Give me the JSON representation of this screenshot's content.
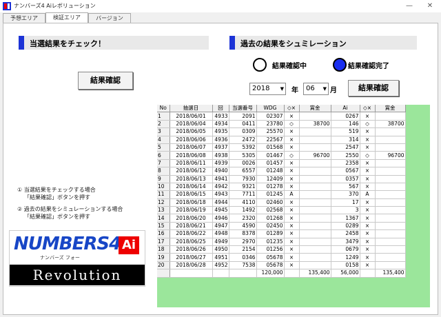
{
  "window": {
    "title": "ナンバーズ4 Aiレボリューション",
    "minimize": "—",
    "close": "✕"
  },
  "tabs": [
    {
      "label": "予想エリア"
    },
    {
      "label": "検証エリア"
    },
    {
      "label": "バージョン"
    }
  ],
  "left": {
    "heading": "当選結果をチェック！",
    "check_button": "結果確認",
    "note1_line1": "① 当選結果をチェックする場合",
    "note1_line2": "「結果確認」ボタンを押す",
    "note2_line1": "② 過去の結果をシミュレーションする場合",
    "note2_line2": "「結果確認」ボタンを押す"
  },
  "right": {
    "heading": "過去の結果をシュミレーション",
    "radio_pending": "結果確認中",
    "radio_done": "結果確認完了",
    "year": "2018",
    "year_suffix": "年",
    "month": "06",
    "month_suffix": "月",
    "check_button": "結果確認"
  },
  "table": {
    "headers": [
      "No",
      "抽選日",
      "回",
      "当選番号",
      "WDG",
      "◇×",
      "賞金",
      "Ai",
      "◇×",
      "賞金"
    ],
    "rows": [
      [
        "1",
        "2018/06/01",
        "4933",
        "2091",
        "02307",
        "×",
        "",
        "0267",
        "×",
        ""
      ],
      [
        "2",
        "2018/06/04",
        "4934",
        "0411",
        "23780",
        "◇",
        "38700",
        "146",
        "◇",
        "38700"
      ],
      [
        "3",
        "2018/06/05",
        "4935",
        "0309",
        "25570",
        "×",
        "",
        "519",
        "×",
        ""
      ],
      [
        "4",
        "2018/06/06",
        "4936",
        "2472",
        "22567",
        "×",
        "",
        "314",
        "×",
        ""
      ],
      [
        "5",
        "2018/06/07",
        "4937",
        "5392",
        "01568",
        "×",
        "",
        "2547",
        "×",
        ""
      ],
      [
        "6",
        "2018/06/08",
        "4938",
        "5305",
        "01467",
        "◇",
        "96700",
        "2550",
        "◇",
        "96700"
      ],
      [
        "7",
        "2018/06/11",
        "4939",
        "0026",
        "01457",
        "×",
        "",
        "2358",
        "×",
        ""
      ],
      [
        "8",
        "2018/06/12",
        "4940",
        "6557",
        "01248",
        "×",
        "",
        "0567",
        "×",
        ""
      ],
      [
        "9",
        "2018/06/13",
        "4941",
        "7930",
        "12409",
        "×",
        "",
        "0357",
        "×",
        ""
      ],
      [
        "10",
        "2018/06/14",
        "4942",
        "9321",
        "01278",
        "×",
        "",
        "567",
        "×",
        ""
      ],
      [
        "11",
        "2018/06/15",
        "4943",
        "7711",
        "01245",
        "A",
        "",
        "370",
        "A",
        ""
      ],
      [
        "12",
        "2018/06/18",
        "4944",
        "4110",
        "02460",
        "×",
        "",
        "17",
        "×",
        ""
      ],
      [
        "13",
        "2018/06/19",
        "4945",
        "1492",
        "02568",
        "×",
        "",
        "3",
        "×",
        ""
      ],
      [
        "14",
        "2018/06/20",
        "4946",
        "2320",
        "01268",
        "×",
        "",
        "1367",
        "×",
        ""
      ],
      [
        "15",
        "2018/06/21",
        "4947",
        "4590",
        "02450",
        "×",
        "",
        "0289",
        "×",
        ""
      ],
      [
        "16",
        "2018/06/22",
        "4948",
        "8378",
        "01289",
        "×",
        "",
        "2458",
        "×",
        ""
      ],
      [
        "17",
        "2018/06/25",
        "4949",
        "2970",
        "01235",
        "×",
        "",
        "3479",
        "×",
        ""
      ],
      [
        "18",
        "2018/06/26",
        "4950",
        "2154",
        "01256",
        "×",
        "",
        "0679",
        "×",
        ""
      ],
      [
        "19",
        "2018/06/27",
        "4951",
        "0346",
        "05678",
        "×",
        "",
        "1249",
        "×",
        ""
      ],
      [
        "20",
        "2018/06/28",
        "4952",
        "7538",
        "05678",
        "×",
        "",
        "0158",
        "×",
        ""
      ]
    ],
    "totals": [
      "",
      "",
      "",
      "",
      "120,000",
      "",
      "135,400",
      "56,000",
      "",
      "135,400"
    ]
  },
  "logo": {
    "title": "NUMBERS4",
    "ai": "Ai",
    "subtitle": "ナンバーズ フォー",
    "revolution": "Revolution"
  },
  "colors": {
    "accent_bar": "#1c33d6",
    "radio_on": "#1a2ff0",
    "grid_empty": "#9be69b"
  }
}
